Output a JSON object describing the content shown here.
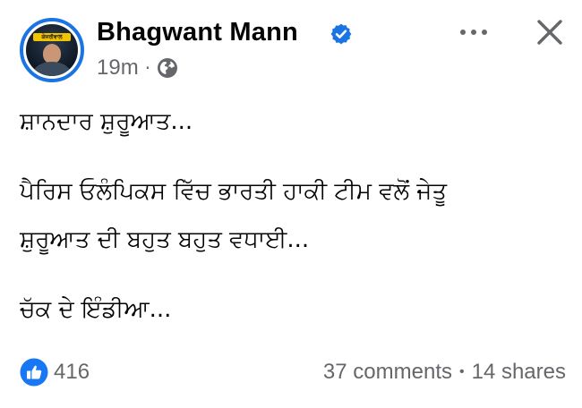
{
  "post": {
    "author": {
      "name": "Bhagwant Mann",
      "avatar_banner_text": "ਕੇਜਰੀਵਾਲ",
      "verified_color": "#1b74e4"
    },
    "timestamp": "19m",
    "meta_separator": "·",
    "audience_icon": "globe-icon",
    "body_lines": [
      "ਸ਼ਾਨਦਾਰ ਸ਼ੁਰੂਆਤ...",
      "ਪੈਰਿਸ ਓਲੰਪਿਕਸ ਵਿੱਚ ਭਾਰਤੀ ਹਾਕੀ ਟੀਮ ਵਲੋਂ ਜੇਤੂ",
      "ਸ਼ੁਰੂਆਤ ਦੀ ਬਹੁਤ ਬਹੁਤ ਵਧਾਈ...",
      "ਚੱਕ ਦੇ ਇੰਡੀਆ..."
    ],
    "reactions": {
      "icon": "like-icon",
      "count": "416",
      "color": "#1877f2"
    },
    "comments_label": "37 comments",
    "shares_separator": "•",
    "shares_label": "14 shares"
  },
  "controls": {
    "more_icon": "more-icon",
    "close_icon": "close-icon"
  }
}
